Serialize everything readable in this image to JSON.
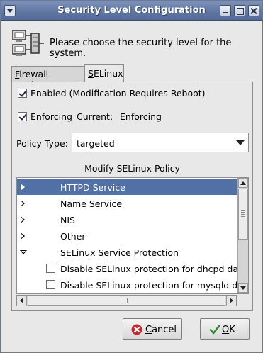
{
  "window": {
    "title": "Security Level Configuration"
  },
  "header": {
    "text": "Please choose the security level for the system.",
    "icon": "network-security-icon"
  },
  "tabs": [
    {
      "label": "Firewall Options",
      "mnemonic": "F",
      "rest": "irewall Options",
      "selected": false
    },
    {
      "label": "SELinux",
      "mnemonic": "S",
      "rest": "ELinux",
      "selected": true
    }
  ],
  "selinux": {
    "enabled_label": "Enabled (Modification Requires Reboot)",
    "enabled_checked": true,
    "enforcing_label": "Enforcing",
    "enforcing_checked": true,
    "current_label": "Current:",
    "current_value": "Enforcing",
    "policy_type_label": "Policy Type:",
    "policy_type_value": "targeted",
    "modify_title": "Modify SELinux Policy"
  },
  "policy_tree": [
    {
      "label": "HTTPD Service",
      "expanded": false,
      "selected": true
    },
    {
      "label": "Name Service",
      "expanded": false,
      "selected": false
    },
    {
      "label": "NIS",
      "expanded": false,
      "selected": false
    },
    {
      "label": "Other",
      "expanded": false,
      "selected": false
    },
    {
      "label": "SELinux Service Protection",
      "expanded": true,
      "selected": false
    },
    {
      "label": "Disable SELinux protection for dhcpd daem",
      "checked": false
    },
    {
      "label": "Disable SELinux protection for mysqld dae",
      "checked": false
    }
  ],
  "buttons": {
    "cancel": {
      "mnemonic": "C",
      "rest": "ancel",
      "icon": "cancel-x-icon"
    },
    "ok": {
      "mnemonic": "O",
      "rest": "K",
      "icon": "checkmark-icon"
    }
  },
  "colors": {
    "titlebar": "#5f76a2",
    "selection": "#5170a5"
  }
}
